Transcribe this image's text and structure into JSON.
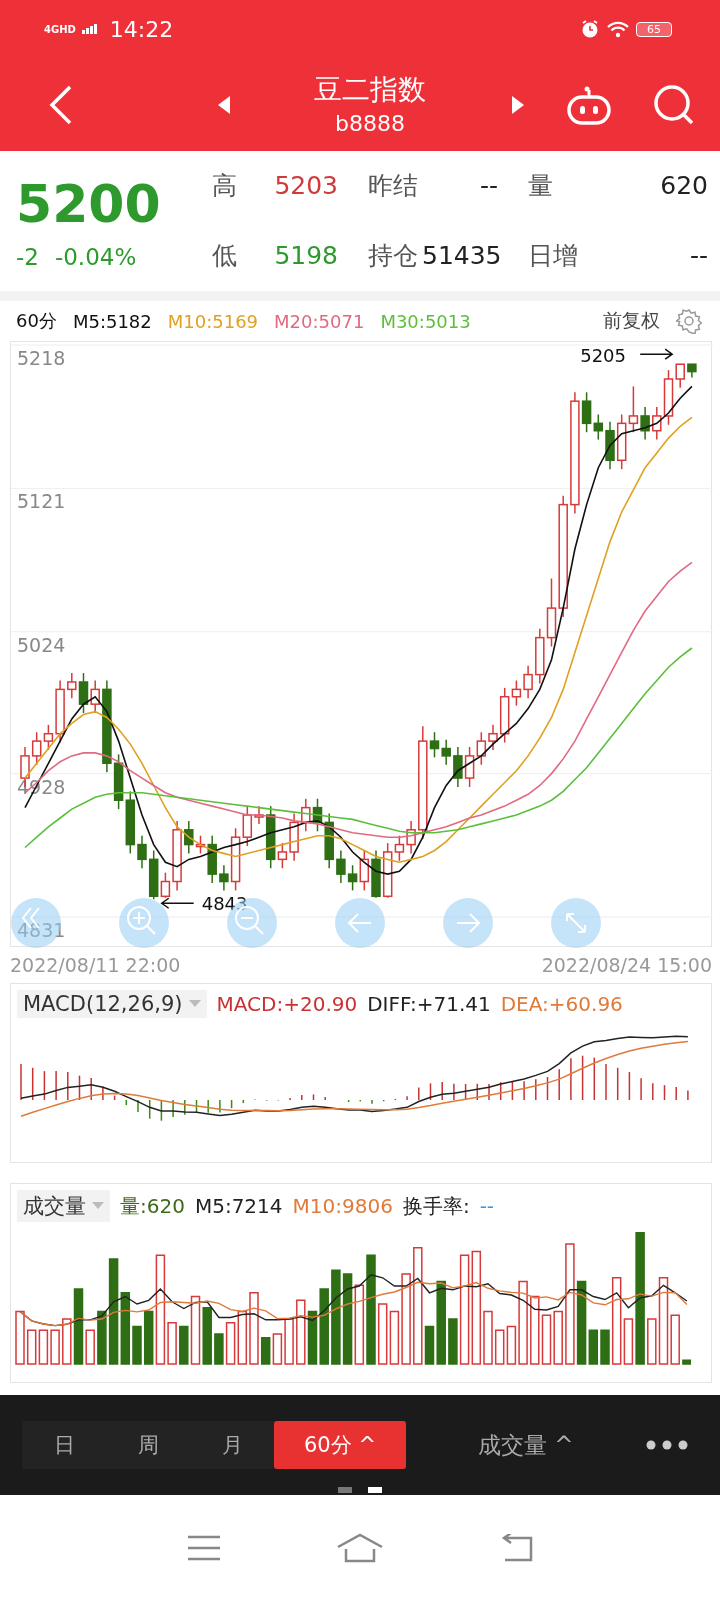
{
  "status_bar": {
    "network": "4GHD",
    "time": "14:22",
    "battery": "65"
  },
  "header": {
    "title": "豆二指数",
    "code": "b8888"
  },
  "quote": {
    "price": "5200",
    "change": "-2",
    "change_pct": "-0.04%",
    "stats": [
      {
        "label": "高",
        "value": "5203",
        "color": "#d03a3a"
      },
      {
        "label": "昨结",
        "value": "--",
        "color": "#222222"
      },
      {
        "label": "量",
        "value": "620",
        "color": "#222222"
      },
      {
        "label": "低",
        "value": "5198",
        "color": "#2e9a2e"
      },
      {
        "label": "持仓",
        "value": "51435",
        "color": "#222222"
      },
      {
        "label": "日增",
        "value": "--",
        "color": "#222222"
      }
    ]
  },
  "kline": {
    "period": "60分",
    "adjust": "前复权",
    "high_mark": "5205",
    "low_mark": "4843",
    "start_time": "2022/08/11 22:00",
    "end_time": "2022/08/24 15:00",
    "chart_data": {
      "type": "candlestick",
      "ylim": [
        4831,
        5218
      ],
      "grid": true,
      "ohlc": [
        [
          4925,
          4946,
          4919,
          4940
        ],
        [
          4940,
          4956,
          4934,
          4950
        ],
        [
          4950,
          4961,
          4944,
          4955
        ],
        [
          4955,
          4991,
          4949,
          4985
        ],
        [
          4985,
          4996,
          4979,
          4990
        ],
        [
          4990,
          4996,
          4969,
          4975
        ],
        [
          4975,
          4991,
          4969,
          4985
        ],
        [
          4985,
          4991,
          4929,
          4935
        ],
        [
          4935,
          4941,
          4904,
          4910
        ],
        [
          4910,
          4916,
          4874,
          4880
        ],
        [
          4880,
          4886,
          4864,
          4870
        ],
        [
          4870,
          4876,
          4843,
          4845
        ],
        [
          4845,
          4861,
          4844,
          4855
        ],
        [
          4855,
          4896,
          4849,
          4890
        ],
        [
          4890,
          4896,
          4874,
          4880
        ],
        [
          4880,
          4886,
          4874,
          4880
        ],
        [
          4880,
          4886,
          4854,
          4860
        ],
        [
          4860,
          4866,
          4849,
          4855
        ],
        [
          4855,
          4891,
          4849,
          4885
        ],
        [
          4885,
          4906,
          4879,
          4900
        ],
        [
          4900,
          4906,
          4894,
          4900
        ],
        [
          4900,
          4906,
          4864,
          4870
        ],
        [
          4870,
          4881,
          4864,
          4875
        ],
        [
          4875,
          4901,
          4869,
          4895
        ],
        [
          4895,
          4911,
          4889,
          4905
        ],
        [
          4905,
          4911,
          4889,
          4895
        ],
        [
          4895,
          4901,
          4864,
          4870
        ],
        [
          4870,
          4876,
          4854,
          4860
        ],
        [
          4860,
          4866,
          4849,
          4855
        ],
        [
          4855,
          4876,
          4849,
          4870
        ],
        [
          4870,
          4876,
          4844,
          4845
        ],
        [
          4845,
          4881,
          4844,
          4875
        ],
        [
          4875,
          4886,
          4869,
          4880
        ],
        [
          4880,
          4896,
          4874,
          4890
        ],
        [
          4890,
          4960,
          4884,
          4950
        ],
        [
          4950,
          4956,
          4939,
          4945
        ],
        [
          4945,
          4951,
          4934,
          4940
        ],
        [
          4940,
          4946,
          4919,
          4925
        ],
        [
          4925,
          4946,
          4919,
          4940
        ],
        [
          4940,
          4956,
          4934,
          4950
        ],
        [
          4950,
          4961,
          4944,
          4955
        ],
        [
          4955,
          4986,
          4949,
          4980
        ],
        [
          4980,
          4991,
          4974,
          4985
        ],
        [
          4985,
          5001,
          4979,
          4995
        ],
        [
          4995,
          5026,
          4989,
          5020
        ],
        [
          5020,
          5060,
          5014,
          5040
        ],
        [
          5040,
          5116,
          5034,
          5110
        ],
        [
          5110,
          5186,
          5104,
          5180
        ],
        [
          5180,
          5186,
          5159,
          5165
        ],
        [
          5165,
          5171,
          5154,
          5160
        ],
        [
          5160,
          5166,
          5134,
          5140
        ],
        [
          5140,
          5171,
          5134,
          5165
        ],
        [
          5165,
          5190,
          5159,
          5170
        ],
        [
          5170,
          5176,
          5154,
          5160
        ],
        [
          5160,
          5176,
          5154,
          5170
        ],
        [
          5170,
          5201,
          5164,
          5195
        ],
        [
          5195,
          5205,
          5189,
          5205
        ],
        [
          5205,
          5205,
          5196,
          5200
        ]
      ],
      "yticks": [
        {
          "value": 5218,
          "label": "5218"
        },
        {
          "value": 5121,
          "label": "5121"
        },
        {
          "value": 5024,
          "label": "5024"
        },
        {
          "value": 4928,
          "label": "4928"
        },
        {
          "value": 4831,
          "label": "4831"
        }
      ],
      "series": [
        {
          "name": "M5:5182",
          "type": "line",
          "color": "#111111",
          "values": [
            4905,
            4920,
            4935,
            4950,
            4965,
            4975,
            4980,
            4970,
            4950,
            4925,
            4900,
            4880,
            4868,
            4865,
            4870,
            4872,
            4875,
            4878,
            4880,
            4882,
            4885,
            4888,
            4890,
            4892,
            4895,
            4896,
            4892,
            4885,
            4875,
            4868,
            4862,
            4860,
            4862,
            4870,
            4885,
            4905,
            4920,
            4930,
            4935,
            4940,
            4948,
            4955,
            4962,
            4972,
            4985,
            5005,
            5040,
            5080,
            5110,
            5135,
            5150,
            5158,
            5160,
            5162,
            5165,
            5172,
            5182,
            5190
          ]
        },
        {
          "name": "M10:5169",
          "type": "line",
          "color": "#e0a020",
          "values": [
            4925,
            4935,
            4945,
            4955,
            4962,
            4968,
            4970,
            4966,
            4958,
            4948,
            4935,
            4920,
            4905,
            4892,
            4885,
            4880,
            4876,
            4874,
            4872,
            4874,
            4876,
            4878,
            4880,
            4882,
            4884,
            4886,
            4886,
            4884,
            4880,
            4876,
            4872,
            4870,
            4868,
            4870,
            4872,
            4876,
            4882,
            4890,
            4898,
            4906,
            4914,
            4922,
            4930,
            4940,
            4952,
            4966,
            4985,
            5010,
            5035,
            5060,
            5085,
            5105,
            5120,
            5135,
            5145,
            5155,
            5163,
            5169
          ]
        },
        {
          "name": "M20:5071",
          "type": "line",
          "color": "#e06a80",
          "values": [
            4915,
            4922,
            4930,
            4936,
            4940,
            4942,
            4942,
            4940,
            4936,
            4930,
            4925,
            4920,
            4915,
            4912,
            4910,
            4908,
            4906,
            4904,
            4902,
            4900,
            4900,
            4899,
            4898,
            4896,
            4895,
            4894,
            4892,
            4890,
            4888,
            4887,
            4886,
            4885,
            4885,
            4886,
            4888,
            4890,
            4892,
            4895,
            4898,
            4900,
            4903,
            4906,
            4910,
            4914,
            4920,
            4928,
            4938,
            4950,
            4965,
            4980,
            4995,
            5010,
            5025,
            5038,
            5048,
            5058,
            5065,
            5071
          ]
        },
        {
          "name": "M30:5013",
          "type": "line",
          "color": "#5cbf3c",
          "values": [
            4878,
            4885,
            4892,
            4898,
            4904,
            4908,
            4912,
            4914,
            4915,
            4915,
            4915,
            4914,
            4913,
            4912,
            4911,
            4910,
            4909,
            4908,
            4907,
            4906,
            4905,
            4904,
            4903,
            4902,
            4901,
            4900,
            4899,
            4898,
            4897,
            4895,
            4893,
            4891,
            4889,
            4888,
            4888,
            4888,
            4889,
            4890,
            4892,
            4894,
            4896,
            4898,
            4900,
            4903,
            4906,
            4910,
            4916,
            4924,
            4932,
            4942,
            4952,
            4962,
            4972,
            4982,
            4991,
            5000,
            5007,
            5013
          ]
        }
      ]
    }
  },
  "macd": {
    "selector": "MACD(12,26,9)",
    "values": [
      {
        "label": "MACD:+20.90",
        "color": "#c83232"
      },
      {
        "label": "DIFF:+71.41",
        "color": "#222222"
      },
      {
        "label": "DEA:+60.96",
        "color": "#e07a3a"
      }
    ]
  },
  "volume": {
    "selector": "成交量",
    "values": [
      {
        "label": "量:620",
        "color": "#3d6b1a"
      },
      {
        "label": "M5:7214",
        "color": "#222222"
      },
      {
        "label": "M10:9806",
        "color": "#e07a3a"
      },
      {
        "label": "换手率:",
        "color": "#222222"
      },
      {
        "label": "--",
        "color": "#3a9ad9"
      }
    ]
  },
  "bottom_bar": {
    "tabs": [
      {
        "label": "日",
        "selected": false
      },
      {
        "label": "周",
        "selected": false
      },
      {
        "label": "月",
        "selected": false
      },
      {
        "label": "60分 ^",
        "selected": true
      }
    ],
    "indicator": "成交量 ^"
  },
  "pager": [
    {
      "selected": false
    },
    {
      "selected": true
    }
  ]
}
